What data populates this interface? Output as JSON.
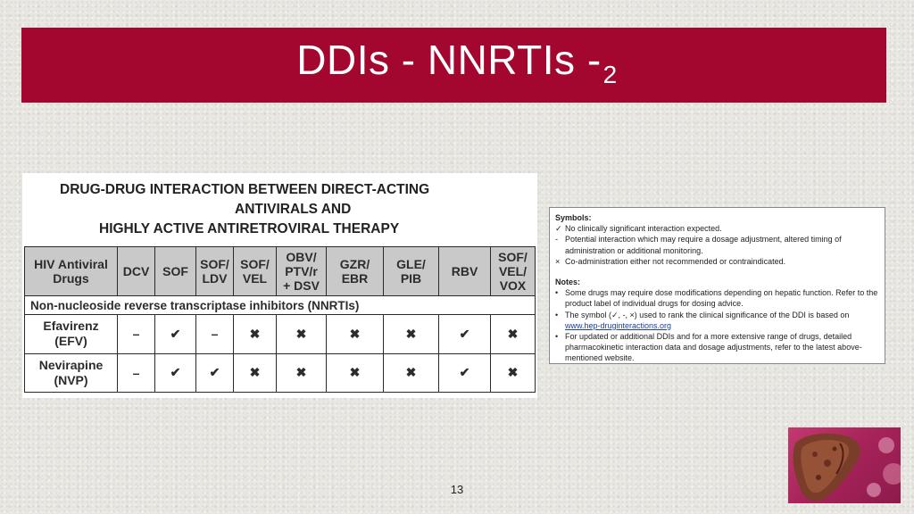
{
  "slide": {
    "title": "DDIs - NNRTIs -",
    "title_subscript": "2",
    "page_number": "13"
  },
  "table": {
    "heading_lines": [
      "DRUG-DRUG INTERACTION BETWEEN DIRECT-ACTING",
      "ANTIVIRALS AND",
      "HIGHLY ACTIVE ANTIRETROVIRAL THERAPY"
    ],
    "columns": [
      [
        "HIV Antiviral",
        "Drugs"
      ],
      [
        "DCV"
      ],
      [
        "SOF"
      ],
      [
        "SOF/",
        "LDV"
      ],
      [
        "SOF/",
        "VEL"
      ],
      [
        "OBV/",
        "PTV/r",
        "+ DSV"
      ],
      [
        "GZR/",
        "EBR"
      ],
      [
        "GLE/",
        "PIB"
      ],
      [
        "RBV"
      ],
      [
        "SOF/",
        "VEL/",
        "VOX"
      ]
    ],
    "category": "Non-nucleoside reverse transcriptase inhibitors (NNRTIs)",
    "rows": [
      {
        "drug": [
          "Efavirenz",
          "(EFV)"
        ],
        "cells": [
          "–",
          "✔",
          "–",
          "✖",
          "✖",
          "✖",
          "✖",
          "✔",
          "✖"
        ]
      },
      {
        "drug": [
          "Nevirapine",
          "(NVP)"
        ],
        "cells": [
          "–",
          "✔",
          "✔",
          "✖",
          "✖",
          "✖",
          "✖",
          "✔",
          "✖"
        ]
      }
    ]
  },
  "symbols_box": {
    "symbols_title": "Symbols:",
    "symbols": [
      {
        "mark": "✓",
        "text": "No clinically significant interaction expected."
      },
      {
        "mark": "-",
        "text": "Potential interaction which may require a dosage adjustment, altered timing of administration or additional monitoring."
      },
      {
        "mark": "×",
        "text": "Co-administration either not recommended or contraindicated."
      }
    ],
    "notes_title": "Notes:",
    "notes": [
      {
        "mark": "•",
        "text": "Some drugs may require dose modifications depending on hepatic function. Refer to the product label of individual drugs for dosing advice."
      },
      {
        "mark": "•",
        "text": "The symbol (✓, -, ×) used to rank the clinical significance of the DDI is based on",
        "link": "www.hep-druginteractions.org"
      },
      {
        "mark": "•",
        "text": "For updated or additional DDIs and for a more extensive range of drugs, detailed pharmacokinetic interaction data and dosage adjustments, refer to the latest above-mentioned website."
      }
    ]
  },
  "colors": {
    "title_bar": "#a3072f",
    "table_header": "#c9c9c9",
    "link": "#1a3ea3"
  }
}
